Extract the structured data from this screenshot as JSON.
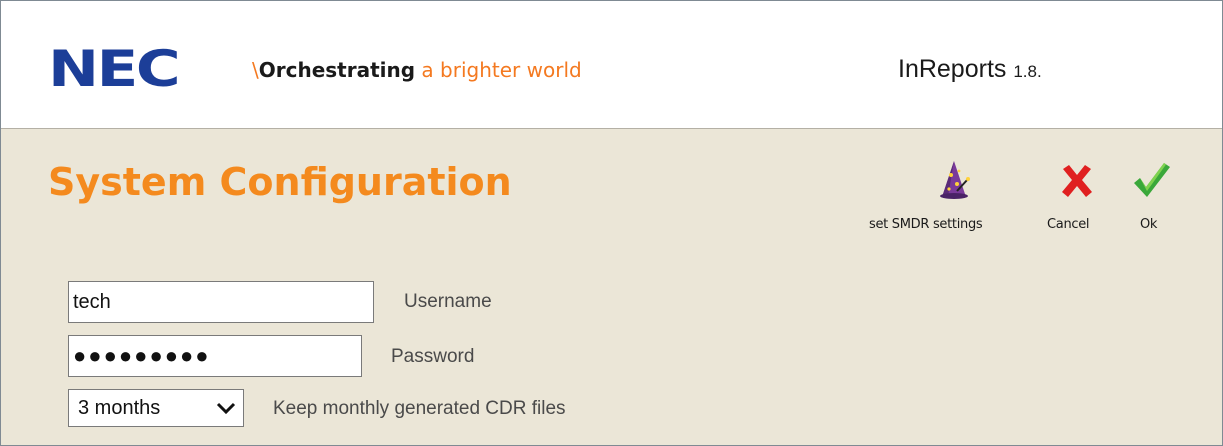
{
  "header": {
    "logo_text": "NEC",
    "tagline_slash": "\\",
    "tagline_part1": "Orchestrating",
    "tagline_part2": " a brighter world",
    "app_name": "InReports",
    "app_version": "1.8."
  },
  "page": {
    "title": "System Configuration"
  },
  "toolbar": {
    "smdr_label": "set SMDR settings",
    "cancel_label": "Cancel",
    "ok_label": "Ok"
  },
  "form": {
    "username": {
      "value": "tech",
      "label": "Username"
    },
    "password": {
      "value": "●●●●●●●●●",
      "label": "Password"
    },
    "retention": {
      "selected": "3 months",
      "label": "Keep monthly generated CDR files"
    }
  },
  "colors": {
    "brand_blue": "#1c3e98",
    "accent_orange": "#f48a1e",
    "background": "#ebe6d7",
    "cancel_red": "#e02020",
    "ok_green": "#3aa83a"
  },
  "icons": {
    "smdr": "wizard-hat-icon",
    "cancel": "x-icon",
    "ok": "checkmark-icon",
    "select": "chevron-down-icon"
  }
}
